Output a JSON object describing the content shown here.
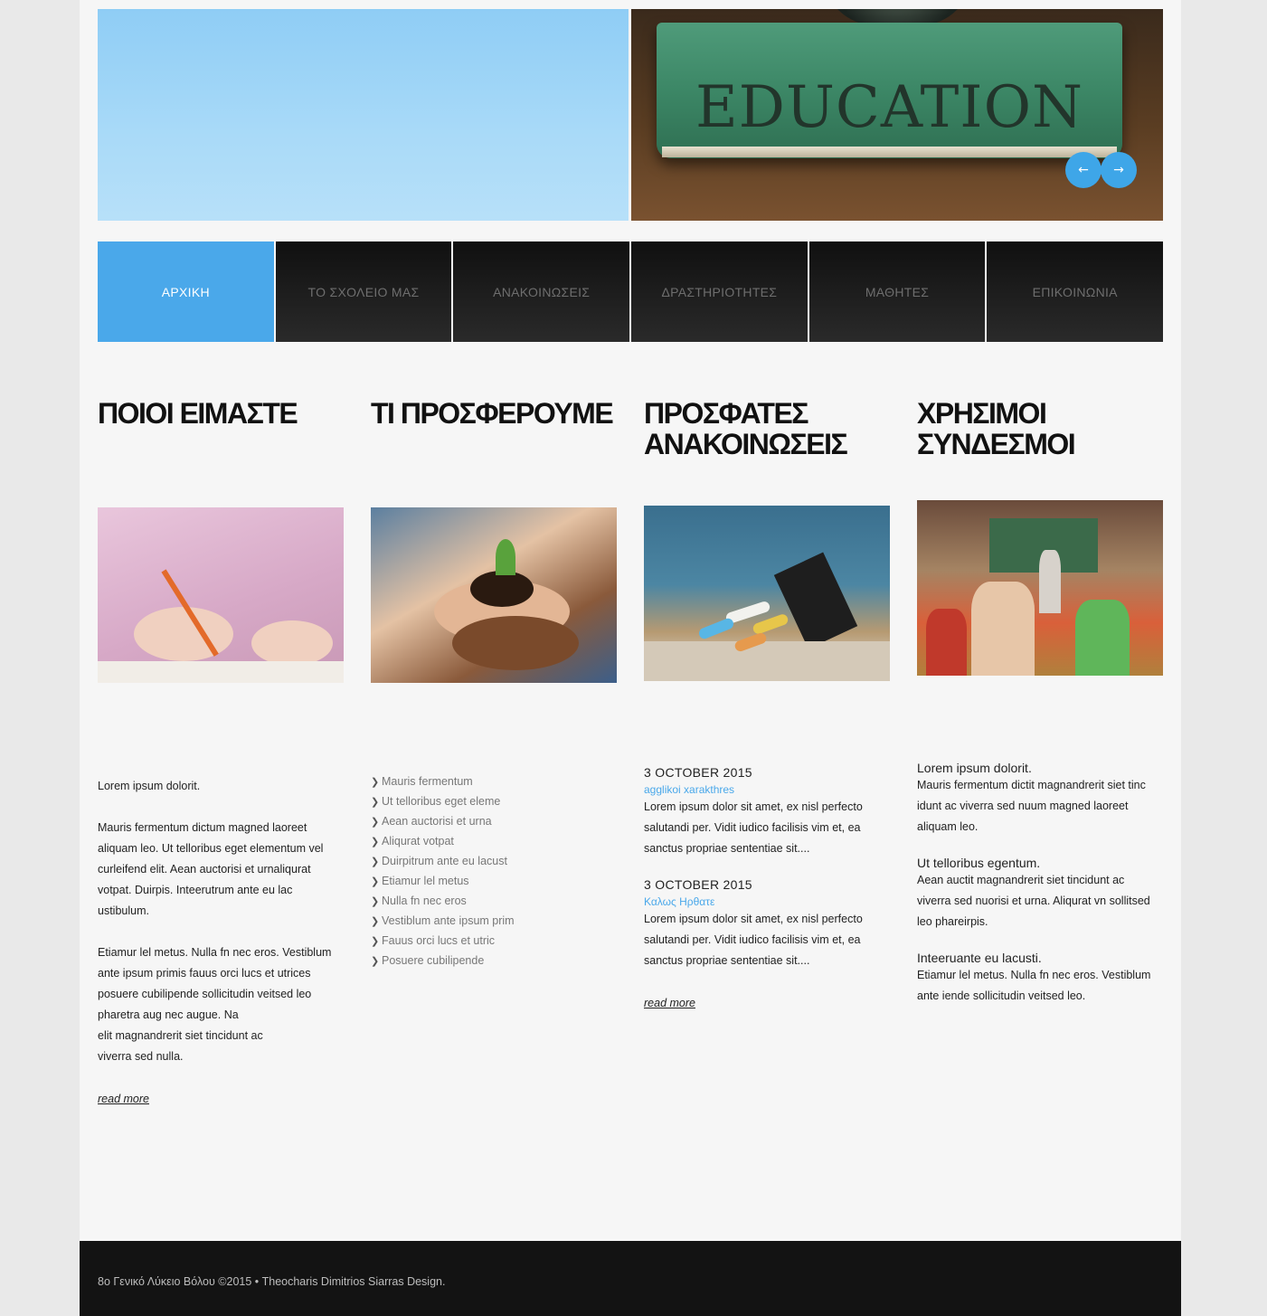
{
  "hero": {
    "book_title": "EDUCATION",
    "prev_label": "←",
    "next_label": "→"
  },
  "nav": {
    "items": [
      {
        "label": "ΑΡΧΙΚΗ"
      },
      {
        "label": "ΤΟ ΣΧΟΛΕΙΟ ΜΑΣ"
      },
      {
        "label": "ΑΝΑΚΟΙΝΩΣΕΙΣ"
      },
      {
        "label": "ΔΡΑΣΤΗΡΙΟΤΗΤΕΣ"
      },
      {
        "label": "ΜΑΘΗΤΕΣ"
      },
      {
        "label": "ΕΠΙΚΟΙΝΩΝΙΑ"
      }
    ],
    "active_index": 0,
    "active_color": "#4aa8ea"
  },
  "col1": {
    "heading": "ΠΟΙΟΙ ΕΙΜΑΣΤΕ",
    "intro": "Lorem ipsum dolorit.",
    "p1_lines": [
      "Mauris fermentum dictum magned laoreet",
      "aliquam leo. Ut telloribus eget elementum vel",
      "curleifend elit. Aean auctorisi et urnaliqurat",
      "votpat. Duirpis. Inteerutrum ante eu lac",
      "ustibulum."
    ],
    "p2_lines": [
      "Etiamur lel metus. Nulla fn nec eros. Vestiblum",
      "ante ipsum primis fauus orci lucs et utrices",
      "posuere cubilipende sollicitudin veitsed leo",
      "pharetra aug nec augue. Na",
      "elit magnandrerit siet tincidunt ac",
      "viverra sed nulla."
    ],
    "read_more": "read more"
  },
  "col2": {
    "heading": "ΤΙ ΠΡΟΣΦΕΡΟΥΜΕ",
    "list": [
      "Mauris fermentum",
      "Ut telloribus eget eleme",
      "Aean auctorisi et urna",
      "Aliqurat votpat",
      "Duirpitrum ante eu lacust",
      "Etiamur lel metus",
      "Nulla fn nec eros",
      "Vestiblum ante ipsum prim",
      "Fauus orci lucs et utric",
      "Posuere cubilipende"
    ]
  },
  "col3": {
    "heading_lines": [
      "ΠΡΟΣΦΑΤΕΣ",
      "ΑΝΑΚΟΙΝΩΣΕΙΣ"
    ],
    "news": [
      {
        "date": "3 OCTOBER 2015",
        "author": "agglikoi xarakthres",
        "lines": [
          "Lorem ipsum dolor sit amet, ex nisl perfecto",
          "salutandi per. Vidit iudico facilisis vim et, ea",
          "sanctus propriae sententiae sit...."
        ]
      },
      {
        "date": "3 OCTOBER 2015",
        "author": "Καλως Ηρθατε",
        "lines": [
          "Lorem ipsum dolor sit amet, ex nisl perfecto",
          "salutandi per. Vidit iudico facilisis vim et, ea",
          "sanctus propriae sententiae sit...."
        ]
      }
    ],
    "read_more": "read more"
  },
  "col4": {
    "heading_lines": [
      "ΧΡΗΣΙΜΟΙ",
      "ΣΥΝΔΕΣΜΟΙ"
    ],
    "blocks": [
      {
        "title": " Lorem ipsum dolorit.",
        "lines": [
          "Mauris fermentum dictit magnandrerit siet tinc",
          "idunt ac viverra sed nuum magned laoreet",
          "aliquam leo."
        ]
      },
      {
        "title": "Ut telloribus egentum.",
        "lines": [
          "Aean auctit magnandrerit siet tincidunt ac",
          "viverra sed nuorisi et urna. Aliqurat vn sollitsed",
          "leo phareirpis."
        ]
      },
      {
        "title": "Inteeruante eu lacusti.",
        "lines": [
          "Etiamur lel metus. Nulla fn nec eros. Vestiblum",
          "ante iende sollicitudin veitsed leo."
        ]
      }
    ]
  },
  "footer": {
    "text": "8ο Γενικό Λύκειο Βόλου ©2015 • Theocharis Dimitrios Siarras Design."
  }
}
